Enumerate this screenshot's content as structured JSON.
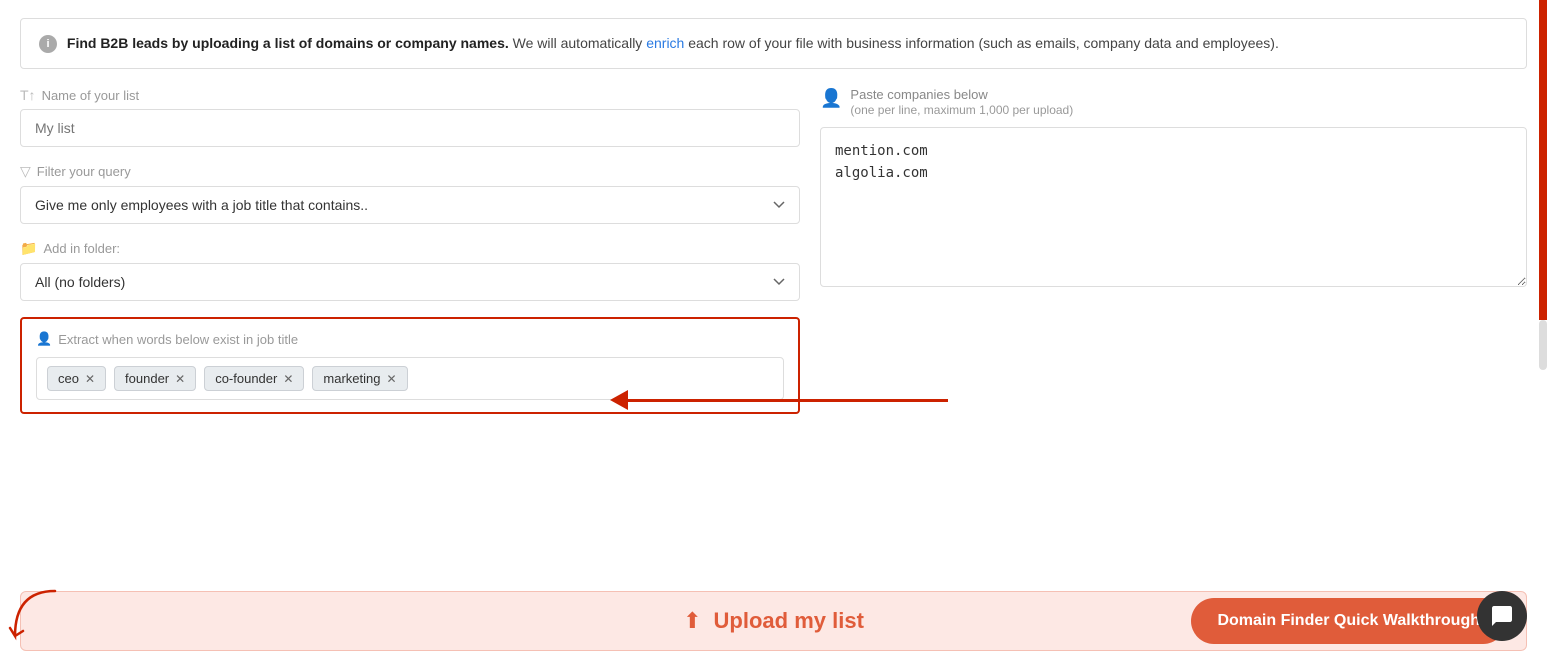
{
  "info_banner": {
    "icon": "i",
    "text_bold": "Find B2B leads by uploading a list of domains or company names.",
    "text_normal": " We will automatically ",
    "text_link": "enrich",
    "text_end": " each row of your file with business information (such as emails, company data and employees)."
  },
  "left": {
    "name_label_icon": "T↑",
    "name_label": "Name of your list",
    "name_placeholder": "My list",
    "filter_label_icon": "▽",
    "filter_label": "Filter your query",
    "filter_option": "Give me only employees with a job title that contains..",
    "folder_label_icon": "📁",
    "folder_label": "Add in folder:",
    "folder_option": "All (no folders)",
    "tags_label_icon": "👤",
    "tags_label": "Extract when words below exist in job title",
    "tags": [
      {
        "text": "ceo"
      },
      {
        "text": "founder"
      },
      {
        "text": "co-founder"
      },
      {
        "text": "marketing"
      }
    ]
  },
  "right": {
    "paste_label_icon": "👤",
    "paste_label": "Paste companies below",
    "paste_sublabel": "(one per line, maximum 1,000 per upload)",
    "paste_content": "mention.com\nalgolia.com"
  },
  "action_bar": {
    "upload_icon": "⬆",
    "upload_label": "Upload my list",
    "walkthrough_label": "Domain Finder Quick Walkthrough"
  },
  "chat_icon": "💬"
}
